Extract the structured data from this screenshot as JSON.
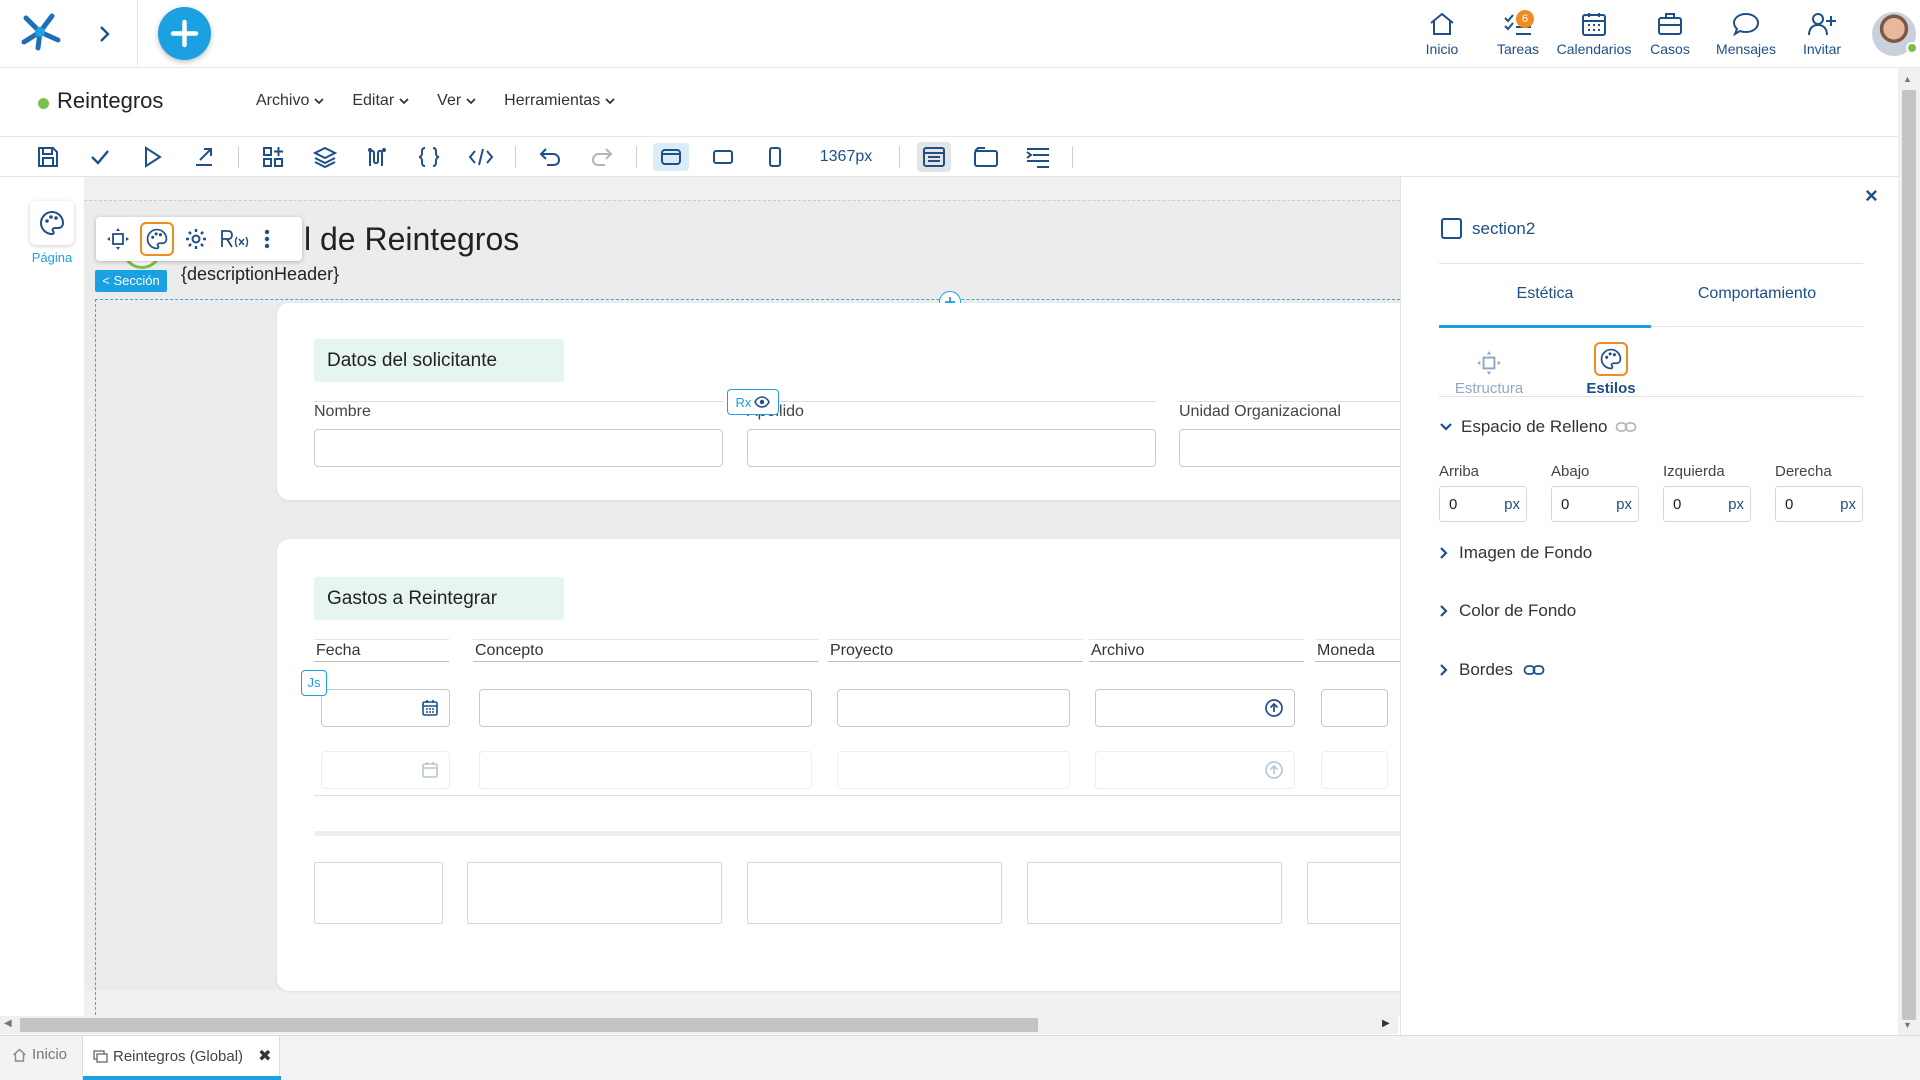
{
  "nav": {
    "items": [
      {
        "label": "Inicio",
        "icon": "home-icon"
      },
      {
        "label": "Tareas",
        "icon": "tasks-icon",
        "badge": "6"
      },
      {
        "label": "Calendarios",
        "icon": "calendar-icon"
      },
      {
        "label": "Casos",
        "icon": "briefcase-icon"
      },
      {
        "label": "Mensajes",
        "icon": "message-icon"
      },
      {
        "label": "Invitar",
        "icon": "invite-user-icon"
      }
    ]
  },
  "title": "Reintegros",
  "menus": [
    "Archivo",
    "Editar",
    "Ver",
    "Herramientas"
  ],
  "toolbar": {
    "width_label": "1367px"
  },
  "page_label": "Página",
  "form": {
    "title_visible": "l de Reintegros",
    "description": "{descriptionHeader}",
    "section_tag": "< Sección",
    "rx_tag": "Rx",
    "js_tag": "Js",
    "section1": {
      "title": "Datos del solicitante",
      "fields": [
        "Nombre",
        "Apellido",
        "Unidad Organizacional"
      ]
    },
    "section2": {
      "title": "Gastos a Reintegrar",
      "columns": [
        "Fecha",
        "Concepto",
        "Proyecto",
        "Archivo",
        "Moneda"
      ]
    }
  },
  "panel": {
    "close": "×",
    "element_name": "section2",
    "tabs": [
      "Estética",
      "Comportamiento"
    ],
    "subtabs": [
      "Estructura",
      "Estilos"
    ],
    "padding": {
      "title": "Espacio de Relleno",
      "fields": [
        {
          "label": "Arriba",
          "value": "0",
          "unit": "px"
        },
        {
          "label": "Abajo",
          "value": "0",
          "unit": "px"
        },
        {
          "label": "Izquierda",
          "value": "0",
          "unit": "px"
        },
        {
          "label": "Derecha",
          "value": "0",
          "unit": "px"
        }
      ]
    },
    "sections": [
      "Imagen de Fondo",
      "Color de Fondo",
      "Bordes"
    ]
  },
  "bottom_tabs": [
    {
      "label": "Inicio"
    },
    {
      "label": "Reintegros (Global)"
    }
  ],
  "colors": {
    "accent": "#1ba1e2",
    "navy": "#1e4f86",
    "orange": "#f08c1f",
    "status": "#7cc04b"
  }
}
